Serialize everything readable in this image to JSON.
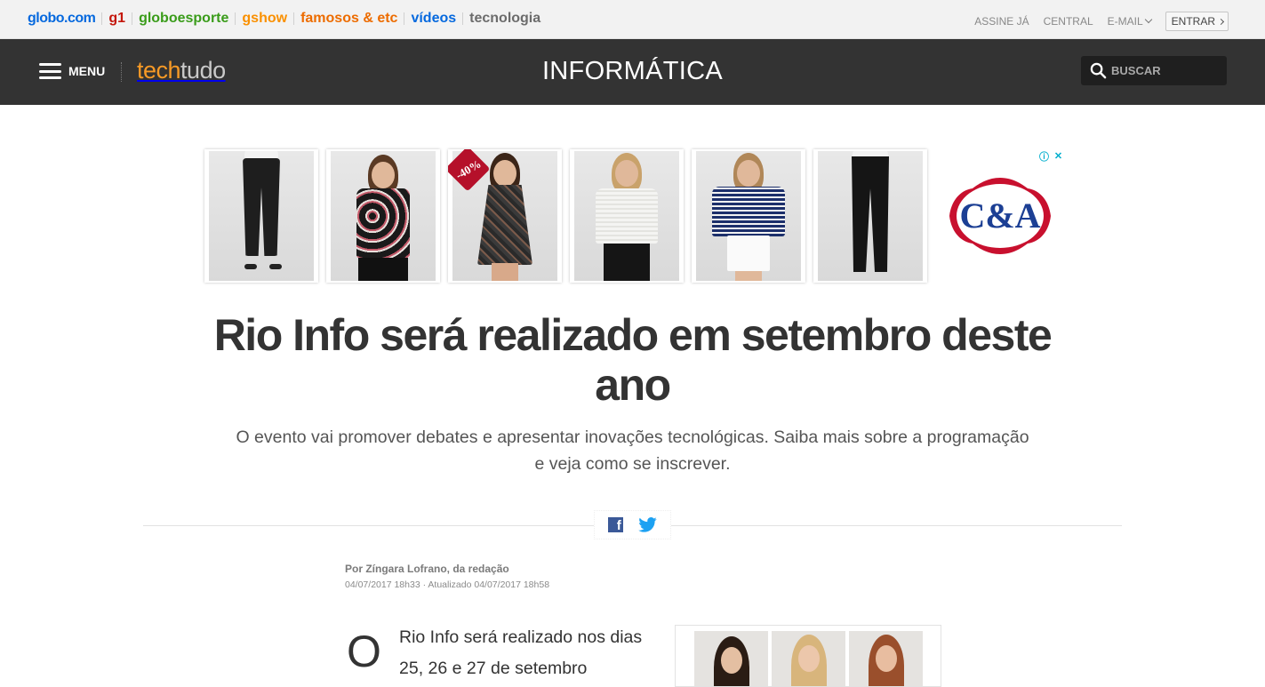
{
  "globo_bar": {
    "links": [
      "globo.com",
      "g1",
      "globoesporte",
      "gshow",
      "famosos & etc",
      "vídeos",
      "tecnologia"
    ],
    "right": {
      "assine": "ASSINE JÁ",
      "central": "CENTRAL",
      "email": "E-MAIL",
      "entrar": "ENTRAR"
    }
  },
  "header": {
    "menu_label": "MENU",
    "logo_tech": "tech",
    "logo_tudo": "tudo",
    "section": "INFORMÁTICA",
    "search_placeholder": "BUSCAR"
  },
  "ad": {
    "discount_badge": "-40%",
    "brand": "C&A",
    "info_icon": "ⓘ",
    "close_icon": "✕"
  },
  "article": {
    "headline": "Rio Info será realizado em setembro deste ano",
    "subheadline": "O evento vai promover debates e apresentar inovações tecnológicas. Saiba mais sobre a programação e veja como se inscrever.",
    "byline": "Por Zíngara Lofrano, da redação",
    "dates": "04/07/2017 18h33 · Atualizado 04/07/2017 18h58",
    "dropcap": "O",
    "body_start": "Rio Info será realizado nos dias 25, 26 e 27 de setembro"
  },
  "share": {
    "facebook_icon": "f",
    "twitter_icon": "twitter-bird"
  },
  "colors": {
    "header_bg": "#333333",
    "logo_orange": "#f79a26",
    "globo_blue": "#0669de",
    "g1_red": "#c4170c",
    "ge_green": "#3a9c1a",
    "gshow_orange": "#fa9000",
    "facebook": "#3b5998",
    "twitter": "#1da1f2",
    "ca_red": "#c8102e",
    "ca_navy": "#1c3f94"
  }
}
